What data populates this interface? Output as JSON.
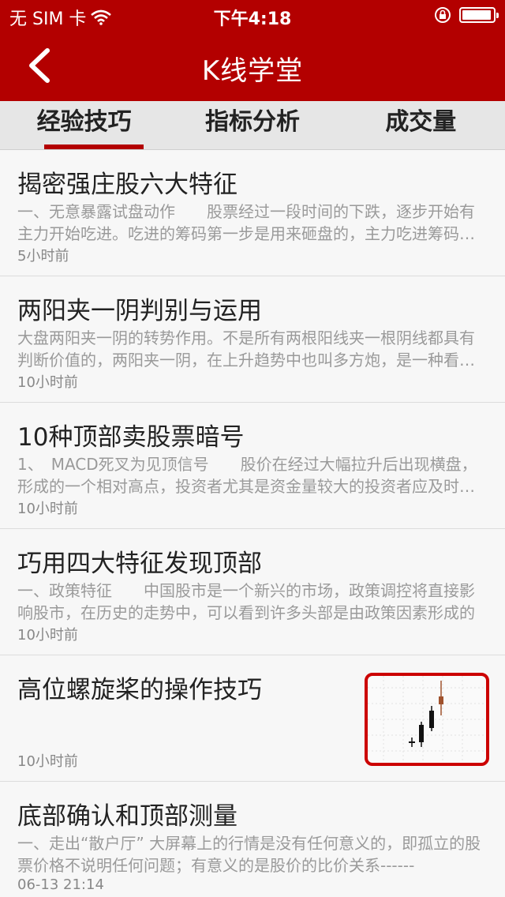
{
  "status_bar": {
    "carrier": "无 SIM 卡",
    "time": "下午4:18",
    "battery_level": 0.95,
    "icons": [
      "wifi-icon",
      "orientation-lock-icon",
      "battery-icon"
    ]
  },
  "nav": {
    "title": "K线学堂",
    "back_icon": "chevron-left-icon"
  },
  "tabs": [
    {
      "label": "经验技巧",
      "active": true
    },
    {
      "label": "指标分析",
      "active": false
    },
    {
      "label": "成交量",
      "active": false
    }
  ],
  "articles": [
    {
      "title": "揭密强庄股六大特征",
      "desc": "一、无意暴露试盘动作　　股票经过一段时间的下跌，逐步开始有主力开始吃进。吃进的筹码第一步是用来砸盘的，主力吃进筹码后再砸盘，散户见股价下跌又纷纷抛出",
      "time": "5小时前"
    },
    {
      "title": "两阳夹一阴判别与运用",
      "desc": "大盘两阳夹一阴的转势作用。不是所有两根阳线夹一根阴线都具有判断价值的，两阳夹一阴，在上升趋势中也叫多方炮，是一种看涨形态",
      "time": "10小时前"
    },
    {
      "title": "10种顶部卖股票暗号",
      "desc": "1、　MACD死叉为见顶信号　　股价在经过大幅拉升后出现横盘，形成的一个相对高点，投资者尤其是资金量较大的投资者应及时出局",
      "time": "10小时前"
    },
    {
      "title": "巧用四大特征发现顶部",
      "desc": "一、政策特征　　中国股市是一个新兴的市场，政策调控将直接影响股市，在历史的走势中，可以看到许多头部是由政策因素形成的",
      "time": "10小时前"
    },
    {
      "title": "高位螺旋桨的操作技巧",
      "desc": "",
      "time": "10小时前",
      "thumbnail": "candlestick-chart-thumbnail"
    },
    {
      "title": "底部确认和顶部测量",
      "desc": "一、走出“散户厅” 大屏幕上的行情是没有任何意义的，即孤立的股票价格不说明任何问题；有意义的是股价的比价关系------",
      "time": "06-13 21:14"
    }
  ],
  "colors": {
    "brand_red": "#b30000",
    "tab_bg": "#e6e6e6",
    "desc_gray": "#9a9a9a"
  }
}
